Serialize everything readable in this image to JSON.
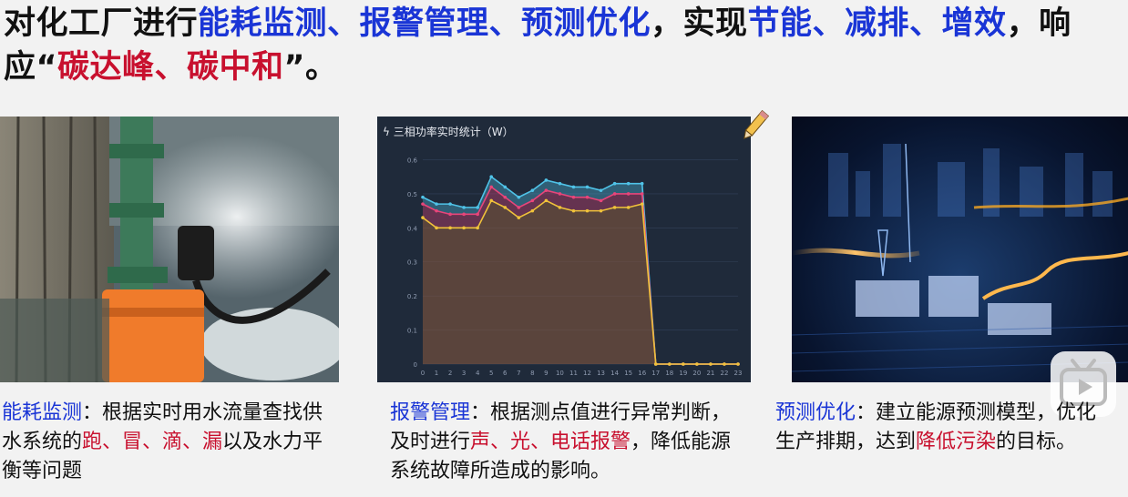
{
  "headline": {
    "p1": "对化工厂进行",
    "p2": "能耗监测、报警管理、预测优化",
    "p3": "，实现",
    "p4": "节能、减排、增效",
    "p5": "，响应“",
    "p6": "碳达峰、碳中和",
    "p7": "”。"
  },
  "captions": {
    "monitor": {
      "key": "能耗监测",
      "t1": "：根据实时用水流量查找供水系统的",
      "hl": "跑、冒、滴、漏",
      "t2": "以及水力平衡等问题"
    },
    "alarm": {
      "key": "报警管理",
      "t1": "：根据测点值进行异常判断，及时进行",
      "hl": "声、光、电话报警",
      "t2": "，降低能源系统故障所造成的影响。"
    },
    "forecast": {
      "key": "预测优化",
      "t1": "：建立能源预测模型，优化生产排期，达到",
      "hl": "降低污染",
      "t2": "的目标。"
    }
  },
  "chart_data": {
    "type": "line",
    "title": "三相功率实时统计（W）",
    "x": [
      0,
      1,
      2,
      3,
      4,
      5,
      6,
      7,
      8,
      9,
      10,
      11,
      12,
      13,
      14,
      15,
      16,
      17,
      18,
      19,
      20,
      21,
      22,
      23
    ],
    "yticks": [
      0,
      0.1,
      0.2,
      0.3,
      0.4,
      0.5,
      0.6
    ],
    "ylim": [
      0,
      0.62
    ],
    "series": [
      {
        "color": "#4fc3e8",
        "values": [
          0.49,
          0.47,
          0.47,
          0.46,
          0.46,
          0.55,
          0.52,
          0.49,
          0.51,
          0.54,
          0.53,
          0.52,
          0.52,
          0.51,
          0.53,
          0.53,
          0.53,
          0,
          0,
          0,
          0,
          0,
          0,
          0
        ]
      },
      {
        "color": "#e8457a",
        "values": [
          0.47,
          0.45,
          0.44,
          0.44,
          0.44,
          0.52,
          0.49,
          0.46,
          0.48,
          0.51,
          0.5,
          0.49,
          0.49,
          0.48,
          0.5,
          0.5,
          0.5,
          0,
          0,
          0,
          0,
          0,
          0,
          0
        ]
      },
      {
        "color": "#f0c23a",
        "values": [
          0.43,
          0.4,
          0.4,
          0.4,
          0.4,
          0.48,
          0.46,
          0.43,
          0.45,
          0.48,
          0.46,
          0.45,
          0.45,
          0.45,
          0.46,
          0.46,
          0.47,
          0,
          0,
          0,
          0,
          0,
          0,
          0
        ]
      }
    ],
    "grid": true,
    "area_fill": true
  },
  "colors": {
    "key_blue": "#1a35d6",
    "highlight_red": "#c8102e",
    "chart_bg": "#1f2a3a"
  },
  "icons": {
    "chart_title": "lightning-icon",
    "overlay": "play-icon",
    "annotation": "pencil-icon"
  }
}
